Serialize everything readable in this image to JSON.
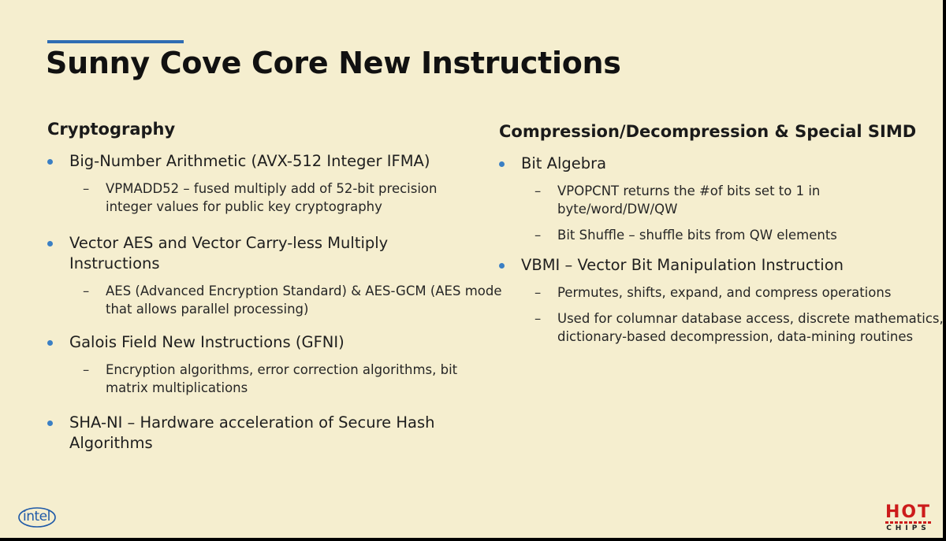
{
  "title": "Sunny Cove Core New Instructions",
  "colors": {
    "accent_blue": "#2f6db3",
    "bullet_blue": "#3a7fc4",
    "background": "#f5eecf",
    "hot_red": "#cc1b1b",
    "intel_blue": "#1f5aa8"
  },
  "left": {
    "heading": "Cryptography",
    "items": [
      {
        "text": "Big-Number Arithmetic (AVX-512 Integer IFMA)",
        "subs": [
          "VPMADD52 – fused multiply add of 52-bit precision integer values for public key cryptography"
        ]
      },
      {
        "text": "Vector AES and Vector Carry-less Multiply Instructions",
        "subs": [
          "AES (Advanced Encryption Standard) & AES-GCM (AES mode that allows parallel processing)"
        ]
      },
      {
        "text": "Galois Field New Instructions (GFNI)",
        "subs": [
          "Encryption algorithms, error correction algorithms, bit matrix multiplications"
        ]
      },
      {
        "text": "SHA-NI – Hardware acceleration of Secure Hash Algorithms",
        "subs": []
      }
    ]
  },
  "right": {
    "heading": "Compression/Decompression & Special SIMD",
    "items": [
      {
        "text": "Bit Algebra",
        "subs": [
          "VPOPCNT returns the #of bits set to 1 in byte/word/DW/QW",
          "Bit Shuffle – shuffle bits from QW elements"
        ]
      },
      {
        "text": "VBMI – Vector Bit Manipulation Instruction",
        "subs": [
          "Permutes, shifts, expand, and compress operations",
          "Used for columnar database access, discrete mathematics, dictionary-based decompression, data-mining routines"
        ]
      }
    ]
  },
  "logos": {
    "intel": "intel",
    "hot": "HOT",
    "chips": "CHIPS"
  }
}
